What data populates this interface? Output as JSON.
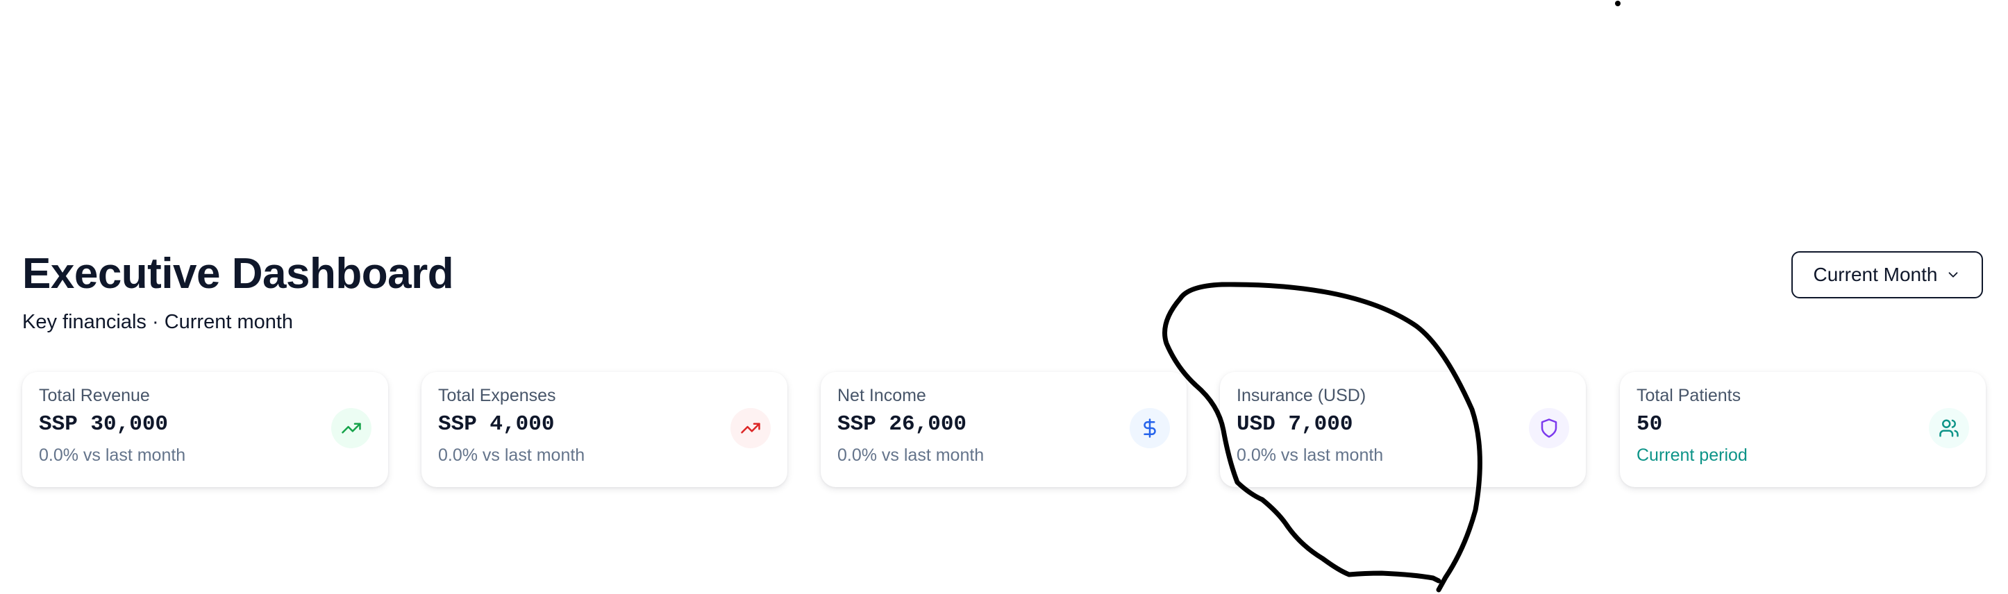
{
  "header": {
    "title": "Executive Dashboard",
    "subtitle": "Key financials · Current month"
  },
  "period_selector": {
    "selected": "Current Month",
    "icon": "chevron-down-icon"
  },
  "cards": [
    {
      "label": "Total Revenue",
      "value": "SSP 30,000",
      "sub": "0.0% vs last month",
      "icon": "trending-up-icon",
      "icon_color": "#16a34a",
      "icon_bg": "#ecfdf3"
    },
    {
      "label": "Total Expenses",
      "value": "SSP 4,000",
      "sub": "0.0% vs last month",
      "icon": "trending-up-icon",
      "icon_color": "#dc2626",
      "icon_bg": "#fef2f2"
    },
    {
      "label": "Net Income",
      "value": "SSP 26,000",
      "sub": "0.0% vs last month",
      "icon": "dollar-icon",
      "icon_color": "#2563eb",
      "icon_bg": "#eff6ff"
    },
    {
      "label": "Insurance (USD)",
      "value": "USD 7,000",
      "sub": "0.0% vs last month",
      "icon": "shield-icon",
      "icon_color": "#7c3aed",
      "icon_bg": "#f5f3ff"
    },
    {
      "label": "Total Patients",
      "value": "50",
      "sub": "Current period",
      "icon": "users-icon",
      "icon_color": "#0d9488",
      "icon_bg": "#f0fdfa"
    }
  ],
  "colors": {
    "text_primary": "#0f172a",
    "text_muted": "#64748b",
    "accent_teal": "#0d9488",
    "annotation_ink": "#000000"
  }
}
